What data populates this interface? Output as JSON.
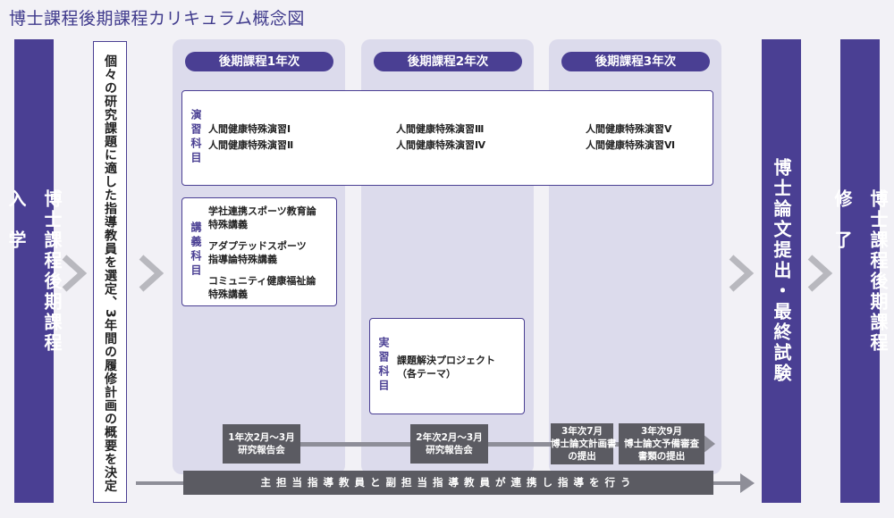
{
  "title": "博士課程後期課程カリキュラム概念図",
  "admission": "博士課程後期課程\n\n入　学",
  "note": "個々の研究課題に適した指導教員を選定、3年間の履修計画の概要を決定",
  "years": [
    "後期課程1年次",
    "後期課程2年次",
    "後期課程3年次"
  ],
  "seminar": {
    "category": "演習科目",
    "items": [
      "人間健康特殊演習Ⅰ",
      "人間健康特殊演習Ⅱ",
      "人間健康特殊演習Ⅲ",
      "人間健康特殊演習Ⅳ",
      "人間健康特殊演習Ⅴ",
      "人間健康特殊演習Ⅵ"
    ]
  },
  "lecture": {
    "category": "講義科目",
    "items": [
      "学社連携スポーツ教育論\n特殊講義",
      "アダプテッドスポーツ\n指導論特殊講義",
      "コミュニティ健康福祉論\n特殊講義"
    ]
  },
  "practice": {
    "category": "実習科目",
    "item": "課題解決プロジェクト\n（各テーマ）"
  },
  "reports": [
    "1年次2月～3月\n研究報告会",
    "2年次2月～3月\n研究報告会",
    "3年次7月\n博士論文計画書\nの提出",
    "3年次9月\n博士論文予備審査\n書類の提出"
  ],
  "guidance": "主担当指導教員と副担当指導教員が連携し指導を行う",
  "thesis": "博士論文提出・最終試験",
  "completion": "博士課程後期課程\n\n修　了",
  "colors": {
    "accent": "#4a3f93",
    "column": "#dcdbec",
    "report": "#5b5b62",
    "arrow": "#b8b8be"
  }
}
